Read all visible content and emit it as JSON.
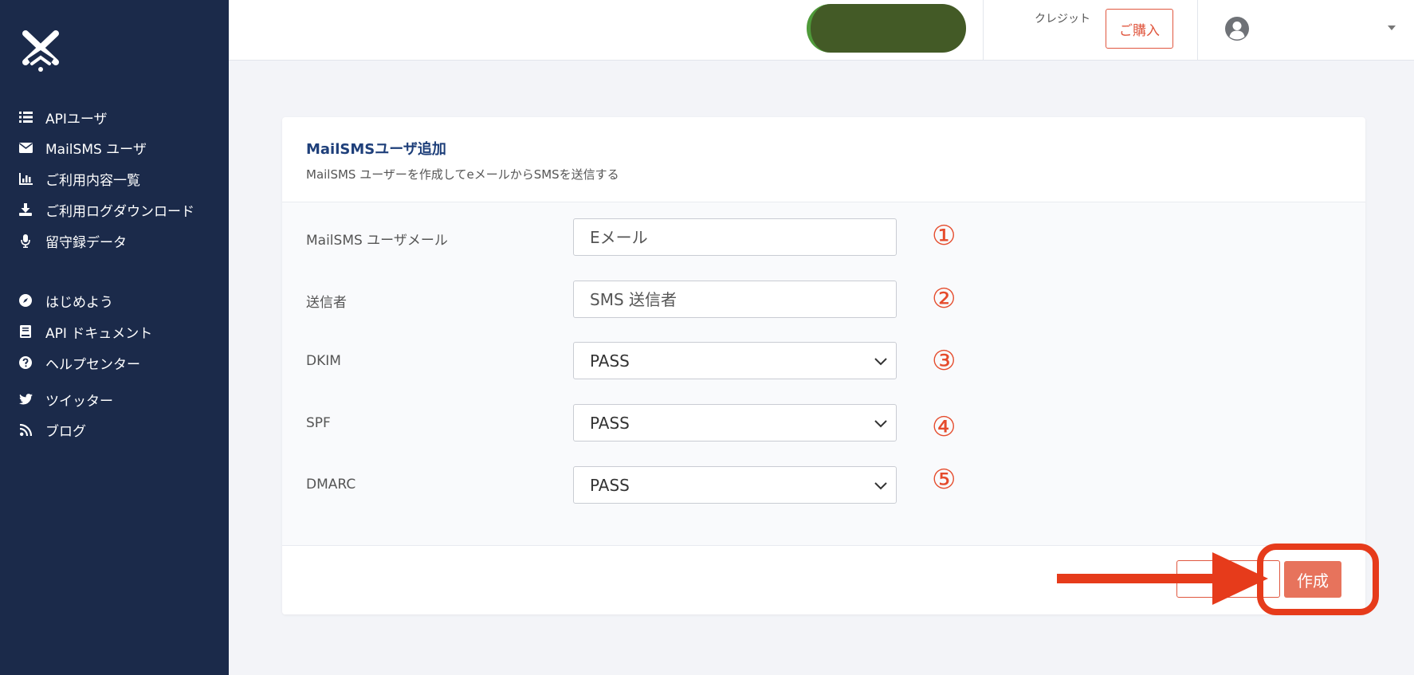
{
  "sidebar": {
    "items": [
      {
        "label": "APIユーザ",
        "icon": "list-icon"
      },
      {
        "label": "MailSMS ユーザ",
        "icon": "envelope-icon"
      },
      {
        "label": "ご利用内容一覧",
        "icon": "bar-chart-icon"
      },
      {
        "label": "ご利用ログダウンロード",
        "icon": "download-icon"
      },
      {
        "label": "留守録データ",
        "icon": "microphone-icon"
      },
      {
        "label": "はじめよう",
        "icon": "compass-icon"
      },
      {
        "label": "API ドキュメント",
        "icon": "book-icon"
      },
      {
        "label": "ヘルプセンター",
        "icon": "question-circle-icon"
      },
      {
        "label": "ツイッター",
        "icon": "twitter-icon"
      },
      {
        "label": "ブログ",
        "icon": "rss-icon"
      }
    ]
  },
  "header": {
    "credit_label": "クレジット",
    "buy_label": "ご購入"
  },
  "form": {
    "title": "MailSMSユーザ追加",
    "subtitle": "MailSMS ユーザーを作成してeメールからSMSを送信する",
    "email_label": "MailSMS ユーザメール",
    "email_placeholder": "Eメール",
    "sender_label": "送信者",
    "sender_placeholder": "SMS 送信者",
    "dkim_label": "DKIM",
    "dkim_value": "PASS",
    "spf_label": "SPF",
    "spf_value": "PASS",
    "dmarc_label": "DMARC",
    "dmarc_value": "PASS",
    "create_label": "作成"
  },
  "annotations": [
    "①",
    "②",
    "③",
    "④",
    "⑤"
  ],
  "colors": {
    "sidebar_bg": "#1b2a4a",
    "accent": "#e0573f",
    "annotation_red": "#e63b1b",
    "title_blue": "#1e3f7a"
  }
}
